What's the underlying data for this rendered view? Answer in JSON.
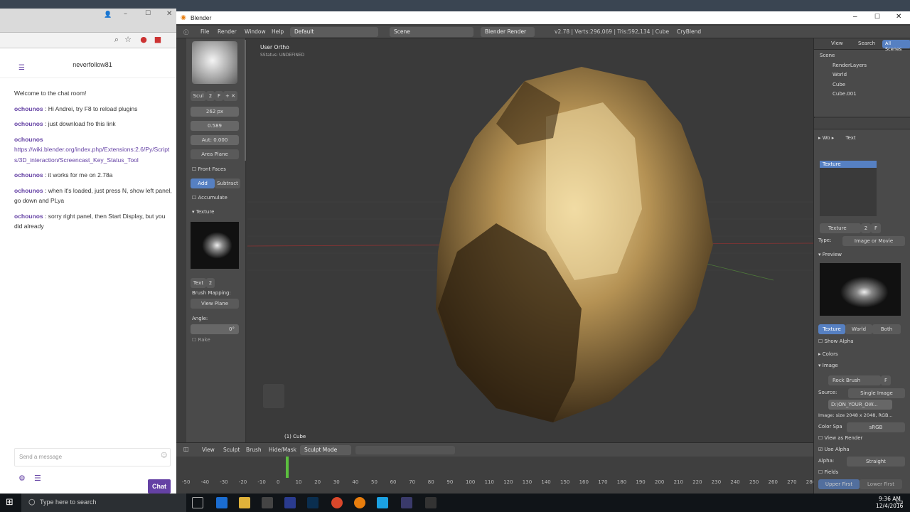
{
  "browser": {
    "channel_name": "neverfollow81",
    "messages": [
      {
        "user": "",
        "text": "Welcome to the chat room!"
      },
      {
        "user": "ochounos",
        "text": ": Hi Andrei, try F8 to reload plugins"
      },
      {
        "user": "ochounos",
        "text": ": just download fro this link"
      },
      {
        "user": "ochounos",
        "text": "",
        "link": "https://wiki.blender.org/index.php/Extensions:2.6/Py/Scripts/3D_interaction/Screencast_Key_Status_Tool"
      },
      {
        "user": "ochounos",
        "text": ": it works for me on 2.78a"
      },
      {
        "user": "ochounos",
        "text": ": when it's loaded, just press N, show left panel, go down and PLya"
      },
      {
        "user": "ochounos",
        "text": ": sorry right panel, then Start Display, but you did already"
      }
    ],
    "input_placeholder": "Send a message",
    "chat_button": "Chat"
  },
  "blender": {
    "title": "Blender",
    "menu": [
      "File",
      "Render",
      "Window",
      "Help"
    ],
    "layout": "Default",
    "scene": "Scene",
    "engine": "Blender Render",
    "stats": "v2.78 | Verts:296,069 | Tris:592,134 | Cube",
    "addon_label": "CryBlend",
    "tool": {
      "brush_name": "Scul",
      "brush_num": "2",
      "brush_f": "F",
      "radius": "262 px",
      "strength": "0.589",
      "autosmooth": "Aut: 0.000",
      "sculpt_plane": "Area Plane",
      "front_faces": "Front Faces",
      "add": "Add",
      "subtract": "Subtract",
      "accumulate": "Accumulate",
      "texture_section": "Texture",
      "tex_name": "Text",
      "tex_num": "2",
      "brush_mapping": "Brush Mapping:",
      "mapping_value": "View Plane",
      "angle_label": "Angle:",
      "angle_value": "0°",
      "rake": "Rake"
    },
    "viewport": {
      "view_name": "User Ortho",
      "status": "SStatus: UNDEFINED",
      "object_label": "(1) Cube"
    },
    "header3d": {
      "items": [
        "View",
        "Sculpt",
        "Brush",
        "Hide/Mask"
      ],
      "mode": "Sculpt Mode"
    },
    "timeline": {
      "ticks": [
        "-50",
        "-40",
        "-30",
        "-20",
        "-10",
        "0",
        "10",
        "20",
        "30",
        "40",
        "50",
        "60",
        "70",
        "80",
        "90",
        "100",
        "110",
        "120",
        "130",
        "140",
        "150",
        "160",
        "170",
        "180",
        "190",
        "200",
        "210",
        "220",
        "230",
        "240",
        "250",
        "260",
        "270",
        "280"
      ],
      "current_frame": 1
    },
    "outliner": {
      "view": "View",
      "search": "Search",
      "filter": "All Scenes",
      "items": [
        "Scene",
        "RenderLayers",
        "World",
        "Cube",
        "Cube.001"
      ]
    },
    "properties": {
      "breadcrumb_wo": "Wo",
      "breadcrumb_text": "Text",
      "slot_name": "Texture",
      "tex_name": "Texture",
      "tex_num": "2",
      "tex_f": "F",
      "type_label": "Type:",
      "type_value": "Image or Movie",
      "preview_label": "Preview",
      "preview_tabs": [
        "Texture",
        "World",
        "Both"
      ],
      "show_alpha": "Show Alpha",
      "colors_label": "Colors",
      "image_label": "Image",
      "image_name": "Rock Brush",
      "image_f": "F",
      "source_label": "Source:",
      "source_value": "Single Image",
      "filepath": "D:\\ON_YOUR_OW...",
      "image_size": "Image: size 2048 x 2048, RGB...",
      "colorspace_label": "Color Spa",
      "colorspace_value": "sRGB",
      "view_as_render": "View as Render",
      "use_alpha": "Use Alpha",
      "alpha_label": "Alpha:",
      "alpha_value": "Straight",
      "fields": "Fields",
      "upper_first": "Upper First",
      "lower_first": "Lower First"
    }
  },
  "taskbar": {
    "search_placeholder": "Type here to search",
    "time": "9:36 AM",
    "date": "12/4/2016"
  }
}
